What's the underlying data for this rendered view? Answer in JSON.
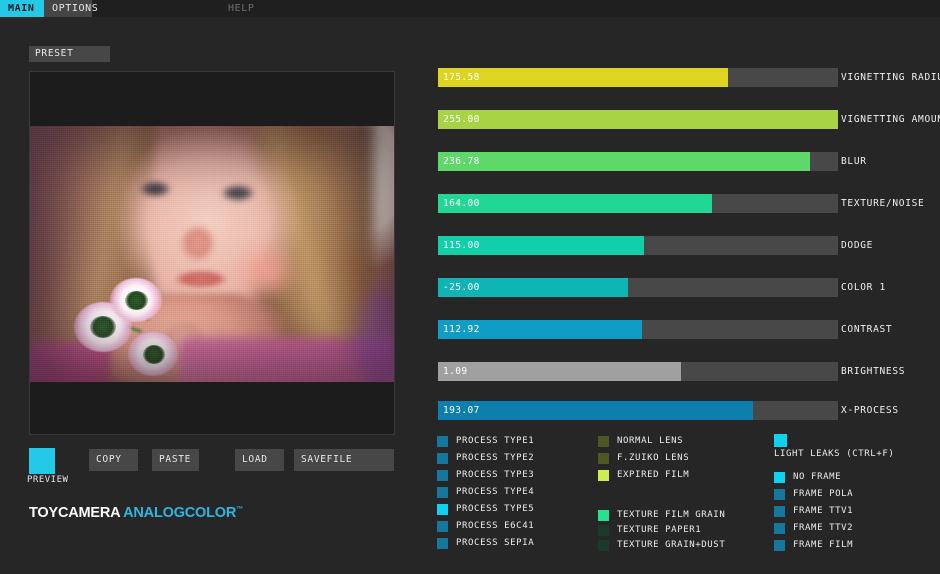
{
  "app": {
    "logo_main": "TOYCAMERA",
    "logo_accent": "ANALOGCOLOR",
    "logo_tm": "™",
    "accent_color": "#25c9e8",
    "panel_color": "#262626",
    "track_color": "#484848"
  },
  "tabs": [
    {
      "label": "MAIN",
      "state": "active"
    },
    {
      "label": "OPTIONS",
      "state": "idle"
    },
    {
      "label": "HELP",
      "state": "help"
    }
  ],
  "preset": {
    "label": "PRESET"
  },
  "preview": {
    "swatch_label": "PREVIEW",
    "swatch_color": "#25c9e8"
  },
  "buttons": {
    "copy": "COPY",
    "paste": "PASTE",
    "load": "LOAD",
    "savefile": "SAVEFILE"
  },
  "sliders": [
    {
      "label": "VIGNETTING RADIUS",
      "value": "175.58",
      "pct": 72.5,
      "color": "#ded422"
    },
    {
      "label": "VIGNETTING AMOUNT",
      "value": "255.00",
      "pct": 100.0,
      "color": "#a7d344"
    },
    {
      "label": "BLUR",
      "value": "236.78",
      "pct": 92.9,
      "color": "#5fd86a"
    },
    {
      "label": "TEXTURE/NOISE",
      "value": "164.00",
      "pct": 68.5,
      "color": "#22d693"
    },
    {
      "label": "DODGE",
      "value": "115.00",
      "pct": 51.5,
      "color": "#11cfa8"
    },
    {
      "label": "COLOR 1",
      "value": "-25.00",
      "pct": 47.5,
      "color": "#0fb5b5"
    },
    {
      "label": "CONTRAST",
      "value": "112.92",
      "pct": 50.9,
      "color": "#0f9dc6"
    },
    {
      "label": "BRIGHTNESS",
      "value": "1.09",
      "pct": 60.8,
      "color": "#a0a0a0"
    },
    {
      "label": "X-PROCESS",
      "value": "193.07",
      "pct": 78.8,
      "color": "#0c7fae"
    }
  ],
  "process_options": [
    {
      "label": "PROCESS TYPE1",
      "selected": false
    },
    {
      "label": "PROCESS TYPE2",
      "selected": false
    },
    {
      "label": "PROCESS TYPE3",
      "selected": false
    },
    {
      "label": "PROCESS TYPE4",
      "selected": false
    },
    {
      "label": "PROCESS TYPE5",
      "selected": true
    },
    {
      "label": "PROCESS E6C41",
      "selected": false
    },
    {
      "label": "PROCESS SEPIA",
      "selected": false
    }
  ],
  "lens_options": [
    {
      "label": "NORMAL LENS",
      "selected": false
    },
    {
      "label": "F.ZUIKO LENS",
      "selected": false
    },
    {
      "label": "EXPIRED FILM",
      "selected": true
    }
  ],
  "texture_options": [
    {
      "label": "TEXTURE FILM GRAIN",
      "selected": true
    },
    {
      "label": "TEXTURE PAPER1",
      "selected": false
    },
    {
      "label": "TEXTURE GRAIN+DUST",
      "selected": false
    }
  ],
  "light_leaks": {
    "label": "LIGHT LEAKS (CTRL+F)",
    "selected": true
  },
  "frame_options": [
    {
      "label": "NO FRAME",
      "selected": true
    },
    {
      "label": "FRAME POLA",
      "selected": false
    },
    {
      "label": "FRAME TTV1",
      "selected": false
    },
    {
      "label": "FRAME TTV2",
      "selected": false
    },
    {
      "label": "FRAME FILM",
      "selected": false
    }
  ],
  "swatch_colors": {
    "process_on": "#10d2ee",
    "process_off": "#14779b",
    "lens_on": "#cdee4e",
    "lens_off": "#4e5622",
    "texture_on": "#25e08f",
    "texture_off": "#1a3a2c",
    "frame_on": "#10d2ee",
    "frame_off": "#14779b"
  }
}
